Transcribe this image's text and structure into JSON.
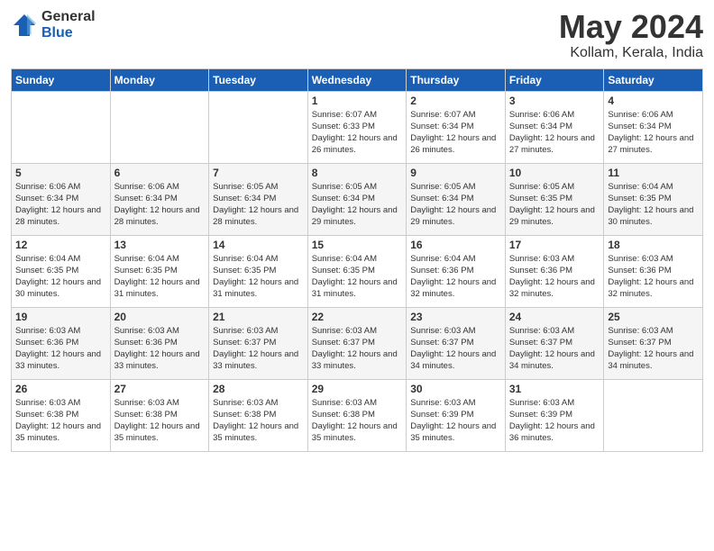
{
  "logo": {
    "general": "General",
    "blue": "Blue"
  },
  "header": {
    "month": "May 2024",
    "location": "Kollam, Kerala, India"
  },
  "weekdays": [
    "Sunday",
    "Monday",
    "Tuesday",
    "Wednesday",
    "Thursday",
    "Friday",
    "Saturday"
  ],
  "weeks": [
    [
      {
        "day": "",
        "info": ""
      },
      {
        "day": "",
        "info": ""
      },
      {
        "day": "",
        "info": ""
      },
      {
        "day": "1",
        "info": "Sunrise: 6:07 AM\nSunset: 6:33 PM\nDaylight: 12 hours\nand 26 minutes."
      },
      {
        "day": "2",
        "info": "Sunrise: 6:07 AM\nSunset: 6:34 PM\nDaylight: 12 hours\nand 26 minutes."
      },
      {
        "day": "3",
        "info": "Sunrise: 6:06 AM\nSunset: 6:34 PM\nDaylight: 12 hours\nand 27 minutes."
      },
      {
        "day": "4",
        "info": "Sunrise: 6:06 AM\nSunset: 6:34 PM\nDaylight: 12 hours\nand 27 minutes."
      }
    ],
    [
      {
        "day": "5",
        "info": "Sunrise: 6:06 AM\nSunset: 6:34 PM\nDaylight: 12 hours\nand 28 minutes."
      },
      {
        "day": "6",
        "info": "Sunrise: 6:06 AM\nSunset: 6:34 PM\nDaylight: 12 hours\nand 28 minutes."
      },
      {
        "day": "7",
        "info": "Sunrise: 6:05 AM\nSunset: 6:34 PM\nDaylight: 12 hours\nand 28 minutes."
      },
      {
        "day": "8",
        "info": "Sunrise: 6:05 AM\nSunset: 6:34 PM\nDaylight: 12 hours\nand 29 minutes."
      },
      {
        "day": "9",
        "info": "Sunrise: 6:05 AM\nSunset: 6:34 PM\nDaylight: 12 hours\nand 29 minutes."
      },
      {
        "day": "10",
        "info": "Sunrise: 6:05 AM\nSunset: 6:35 PM\nDaylight: 12 hours\nand 29 minutes."
      },
      {
        "day": "11",
        "info": "Sunrise: 6:04 AM\nSunset: 6:35 PM\nDaylight: 12 hours\nand 30 minutes."
      }
    ],
    [
      {
        "day": "12",
        "info": "Sunrise: 6:04 AM\nSunset: 6:35 PM\nDaylight: 12 hours\nand 30 minutes."
      },
      {
        "day": "13",
        "info": "Sunrise: 6:04 AM\nSunset: 6:35 PM\nDaylight: 12 hours\nand 31 minutes."
      },
      {
        "day": "14",
        "info": "Sunrise: 6:04 AM\nSunset: 6:35 PM\nDaylight: 12 hours\nand 31 minutes."
      },
      {
        "day": "15",
        "info": "Sunrise: 6:04 AM\nSunset: 6:35 PM\nDaylight: 12 hours\nand 31 minutes."
      },
      {
        "day": "16",
        "info": "Sunrise: 6:04 AM\nSunset: 6:36 PM\nDaylight: 12 hours\nand 32 minutes."
      },
      {
        "day": "17",
        "info": "Sunrise: 6:03 AM\nSunset: 6:36 PM\nDaylight: 12 hours\nand 32 minutes."
      },
      {
        "day": "18",
        "info": "Sunrise: 6:03 AM\nSunset: 6:36 PM\nDaylight: 12 hours\nand 32 minutes."
      }
    ],
    [
      {
        "day": "19",
        "info": "Sunrise: 6:03 AM\nSunset: 6:36 PM\nDaylight: 12 hours\nand 33 minutes."
      },
      {
        "day": "20",
        "info": "Sunrise: 6:03 AM\nSunset: 6:36 PM\nDaylight: 12 hours\nand 33 minutes."
      },
      {
        "day": "21",
        "info": "Sunrise: 6:03 AM\nSunset: 6:37 PM\nDaylight: 12 hours\nand 33 minutes."
      },
      {
        "day": "22",
        "info": "Sunrise: 6:03 AM\nSunset: 6:37 PM\nDaylight: 12 hours\nand 33 minutes."
      },
      {
        "day": "23",
        "info": "Sunrise: 6:03 AM\nSunset: 6:37 PM\nDaylight: 12 hours\nand 34 minutes."
      },
      {
        "day": "24",
        "info": "Sunrise: 6:03 AM\nSunset: 6:37 PM\nDaylight: 12 hours\nand 34 minutes."
      },
      {
        "day": "25",
        "info": "Sunrise: 6:03 AM\nSunset: 6:37 PM\nDaylight: 12 hours\nand 34 minutes."
      }
    ],
    [
      {
        "day": "26",
        "info": "Sunrise: 6:03 AM\nSunset: 6:38 PM\nDaylight: 12 hours\nand 35 minutes."
      },
      {
        "day": "27",
        "info": "Sunrise: 6:03 AM\nSunset: 6:38 PM\nDaylight: 12 hours\nand 35 minutes."
      },
      {
        "day": "28",
        "info": "Sunrise: 6:03 AM\nSunset: 6:38 PM\nDaylight: 12 hours\nand 35 minutes."
      },
      {
        "day": "29",
        "info": "Sunrise: 6:03 AM\nSunset: 6:38 PM\nDaylight: 12 hours\nand 35 minutes."
      },
      {
        "day": "30",
        "info": "Sunrise: 6:03 AM\nSunset: 6:39 PM\nDaylight: 12 hours\nand 35 minutes."
      },
      {
        "day": "31",
        "info": "Sunrise: 6:03 AM\nSunset: 6:39 PM\nDaylight: 12 hours\nand 36 minutes."
      },
      {
        "day": "",
        "info": ""
      }
    ]
  ]
}
